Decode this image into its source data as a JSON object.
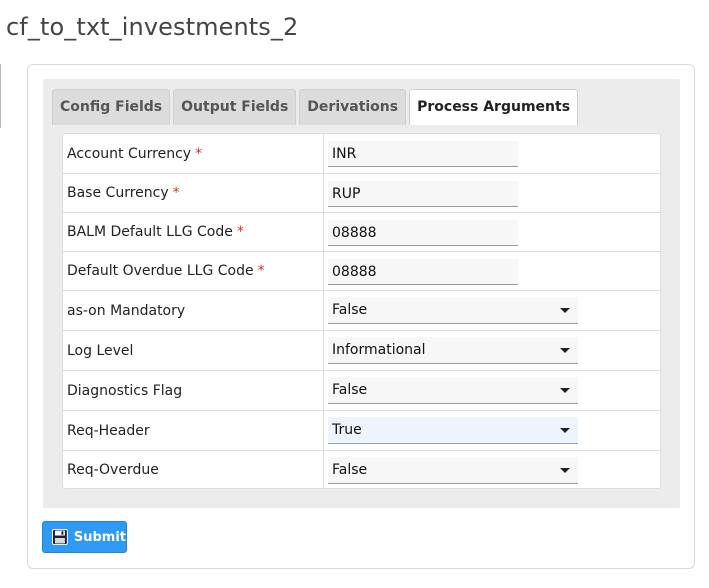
{
  "page": {
    "title": "cf_to_txt_investments_2"
  },
  "tabs": [
    {
      "label": "Config Fields",
      "active": false
    },
    {
      "label": "Output Fields",
      "active": false
    },
    {
      "label": "Derivations",
      "active": false
    },
    {
      "label": "Process Arguments",
      "active": true
    }
  ],
  "form": {
    "required_marker": "*",
    "fields": [
      {
        "label": "Account Currency",
        "required": true,
        "type": "text",
        "value": "INR"
      },
      {
        "label": "Base Currency",
        "required": true,
        "type": "text",
        "value": "RUP"
      },
      {
        "label": "BALM Default LLG Code",
        "required": true,
        "type": "text",
        "value": "08888"
      },
      {
        "label": "Default Overdue LLG Code",
        "required": true,
        "type": "text",
        "value": "08888"
      },
      {
        "label": "as-on Mandatory",
        "required": false,
        "type": "select",
        "value": "False"
      },
      {
        "label": "Log Level",
        "required": false,
        "type": "select",
        "value": "Informational"
      },
      {
        "label": "Diagnostics Flag",
        "required": false,
        "type": "select",
        "value": "False"
      },
      {
        "label": "Req-Header",
        "required": false,
        "type": "select",
        "value": "True"
      },
      {
        "label": "Req-Overdue",
        "required": false,
        "type": "select",
        "value": "False"
      }
    ]
  },
  "actions": {
    "submit_label": "Submit",
    "submit_icon": "save-icon"
  },
  "colors": {
    "accent": "#2e9af2",
    "required": "#d9302c"
  }
}
